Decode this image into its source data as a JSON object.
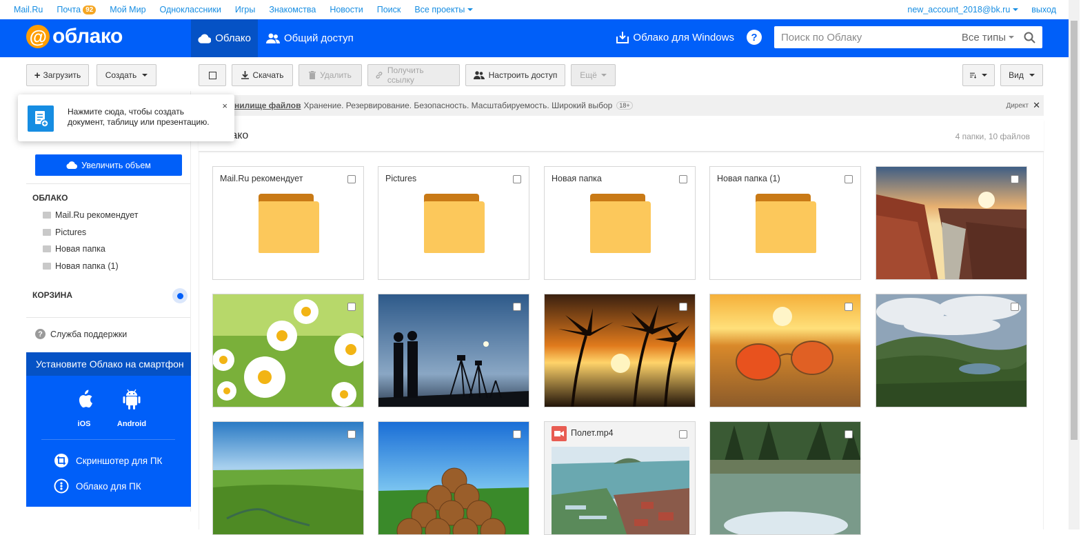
{
  "topnav": {
    "links": [
      "Mail.Ru",
      "Почта",
      "Мой Мир",
      "Одноклассники",
      "Игры",
      "Знакомства",
      "Новости",
      "Поиск",
      "Все проекты"
    ],
    "mail_badge": "92",
    "account": "new_account_2018@bk.ru",
    "logout": "выход"
  },
  "header": {
    "logo_text": "облако",
    "tab_cloud": "Облако",
    "tab_shared": "Общий доступ",
    "windows_link": "Облако для Windows",
    "help": "?",
    "search_placeholder": "Поиск по Облаку",
    "search_types": "Все типы"
  },
  "toolbar": {
    "upload": "Загрузить",
    "create": "Создать",
    "download": "Скачать",
    "delete": "Удалить",
    "get_link": "Получить ссылку",
    "share_access": "Настроить доступ",
    "more": "Ещё",
    "view": "Вид"
  },
  "popover": {
    "text_line1": "Нажмите сюда, чтобы создать",
    "text_line2": "документ, таблицу или презентацию.",
    "close": "×"
  },
  "sidebar": {
    "increase_button": "Увеличить объем",
    "cloud_heading": "ОБЛАКО",
    "folders": [
      "Mail.Ru рекомендует",
      "Pictures",
      "Новая папка",
      "Новая папка (1)"
    ],
    "trash_heading": "КОРЗИНА",
    "support": "Служба поддержки",
    "promo_title": "Установите Облако на смартфон",
    "ios": "iOS",
    "android": "Android",
    "screenshoter": "Скриншотер для ПК",
    "cloud_pc": "Облако для ПК"
  },
  "ad": {
    "link": "нилище файлов",
    "text": "Хранение. Резервирование. Безопасность. Масштабируемость. Широкий выбор",
    "age": "18+",
    "direct": "Директ",
    "close": "✕"
  },
  "main": {
    "title": "лако",
    "counts": "4 папки, 10 файлов",
    "folders": [
      "Mail.Ru рекомендует",
      "Pictures",
      "Новая папка",
      "Новая папка (1)"
    ],
    "video_name": "Полет.mp4"
  },
  "colors": {
    "brand_blue": "#005ff9",
    "folder_yellow": "#fcc85b",
    "folder_tab": "#c97a16",
    "link_blue": "#168de2"
  }
}
